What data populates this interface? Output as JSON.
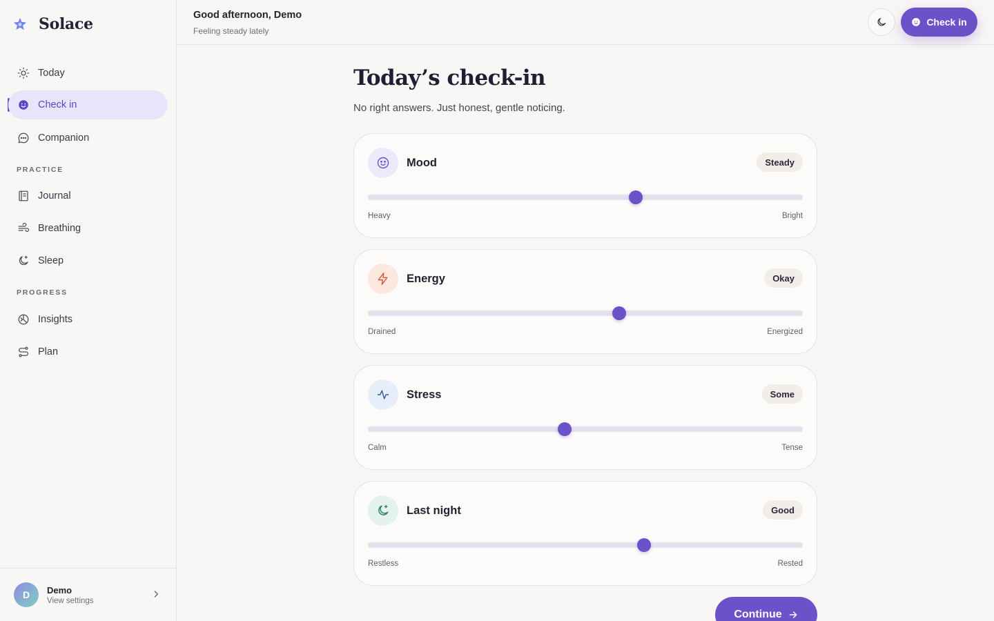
{
  "app": {
    "name": "Solace"
  },
  "sidebar": {
    "top_items": [
      {
        "label": "Today",
        "icon": "sun-icon"
      },
      {
        "label": "Check in",
        "icon": "smile-icon",
        "active": true
      },
      {
        "label": "Companion",
        "icon": "chat-icon"
      }
    ],
    "practice_label": "PRACTICE",
    "practice_items": [
      {
        "label": "Journal",
        "icon": "journal-icon"
      },
      {
        "label": "Breathing",
        "icon": "wind-icon"
      },
      {
        "label": "Sleep",
        "icon": "moon-star-icon"
      }
    ],
    "progress_label": "PROGRESS",
    "progress_items": [
      {
        "label": "Insights",
        "icon": "insights-icon"
      },
      {
        "label": "Plan",
        "icon": "route-icon"
      }
    ],
    "user": {
      "initial": "D",
      "name": "Demo",
      "sub": "View settings"
    }
  },
  "header": {
    "greeting": "Good afternoon, Demo",
    "subtitle": "Feeling steady lately",
    "checkin_label": "Check in"
  },
  "main": {
    "title": "Today’s check-in",
    "subtitle": "No right answers. Just honest, gentle noticing.",
    "cards": [
      {
        "title": "Mood",
        "badge": "Steady",
        "left": "Heavy",
        "right": "Bright",
        "value": 0.616,
        "icon": "smile-icon",
        "icon_bg": "#ece9fb",
        "icon_color": "#6b52c9"
      },
      {
        "title": "Energy",
        "badge": "Okay",
        "left": "Drained",
        "right": "Energized",
        "value": 0.578,
        "icon": "lightning-icon",
        "icon_bg": "#fde8df",
        "icon_color": "#d8583a"
      },
      {
        "title": "Stress",
        "badge": "Some",
        "left": "Calm",
        "right": "Tense",
        "value": 0.452,
        "icon": "pulse-icon",
        "icon_bg": "#e6eefa",
        "icon_color": "#3a5c94"
      },
      {
        "title": "Last night",
        "badge": "Good",
        "left": "Restless",
        "right": "Rested",
        "value": 0.635,
        "icon": "moon-star-icon",
        "icon_bg": "#e3f3ec",
        "icon_color": "#2f7a5c"
      }
    ],
    "continue_label": "Continue"
  }
}
